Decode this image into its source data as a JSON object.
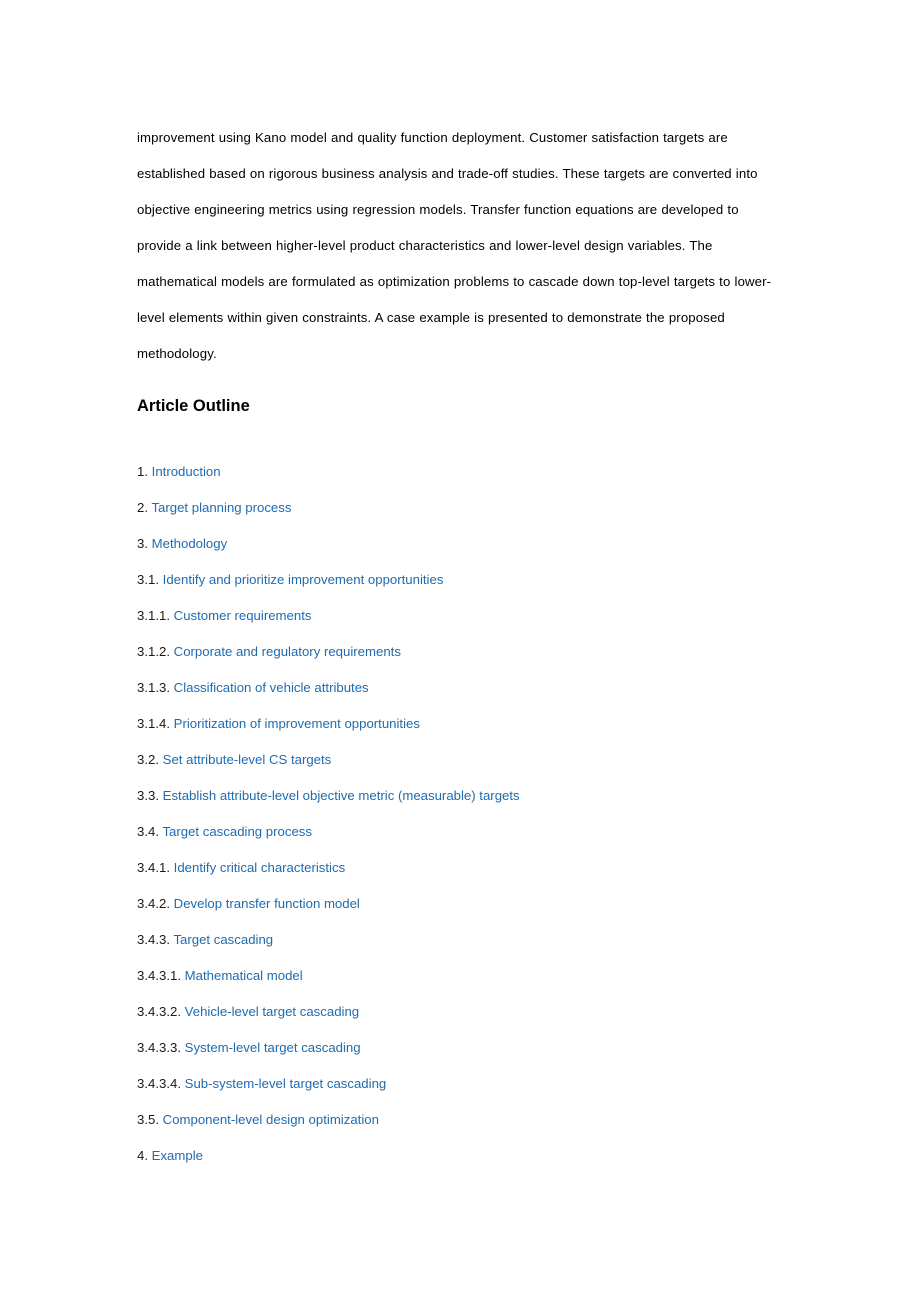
{
  "document": {
    "abstract_text": "improvement using Kano model and quality function deployment. Customer satisfaction targets are established based on rigorous business analysis and trade-off studies. These targets are converted into objective engineering metrics using regression models. Transfer function equations are developed to provide a link between higher-level product characteristics and lower-level design variables. The mathematical models are formulated as optimization problems to cascade down top-level targets to lower-level elements within given constraints. A case example is presented to demonstrate the proposed methodology.",
    "outline_heading": "Article Outline",
    "link_color": "#1f6bb0",
    "text_color": "#000000",
    "background_color": "#ffffff",
    "outline_items": [
      {
        "number": "1.",
        "label": "Introduction"
      },
      {
        "number": "2.",
        "label": "Target planning process"
      },
      {
        "number": "3.",
        "label": "Methodology"
      },
      {
        "number": "3.1.",
        "label": "Identify and prioritize improvement opportunities"
      },
      {
        "number": "3.1.1.",
        "label": "Customer requirements"
      },
      {
        "number": "3.1.2.",
        "label": "Corporate and regulatory requirements"
      },
      {
        "number": "3.1.3.",
        "label": "Classification of vehicle attributes"
      },
      {
        "number": "3.1.4.",
        "label": "Prioritization of improvement opportunities"
      },
      {
        "number": "3.2.",
        "label": "Set attribute-level CS targets"
      },
      {
        "number": "3.3.",
        "label": "Establish attribute-level objective metric (measurable) targets"
      },
      {
        "number": "3.4.",
        "label": "Target cascading process"
      },
      {
        "number": "3.4.1.",
        "label": "Identify critical characteristics"
      },
      {
        "number": "3.4.2.",
        "label": "Develop transfer function model"
      },
      {
        "number": "3.4.3.",
        "label": "Target cascading"
      },
      {
        "number": "3.4.3.1.",
        "label": "Mathematical model"
      },
      {
        "number": "3.4.3.2.",
        "label": "Vehicle-level target cascading"
      },
      {
        "number": "3.4.3.3.",
        "label": "System-level target cascading"
      },
      {
        "number": "3.4.3.4.",
        "label": "Sub-system-level target cascading"
      },
      {
        "number": "3.5.",
        "label": "Component-level design optimization"
      },
      {
        "number": "4.",
        "label": "Example"
      }
    ]
  }
}
